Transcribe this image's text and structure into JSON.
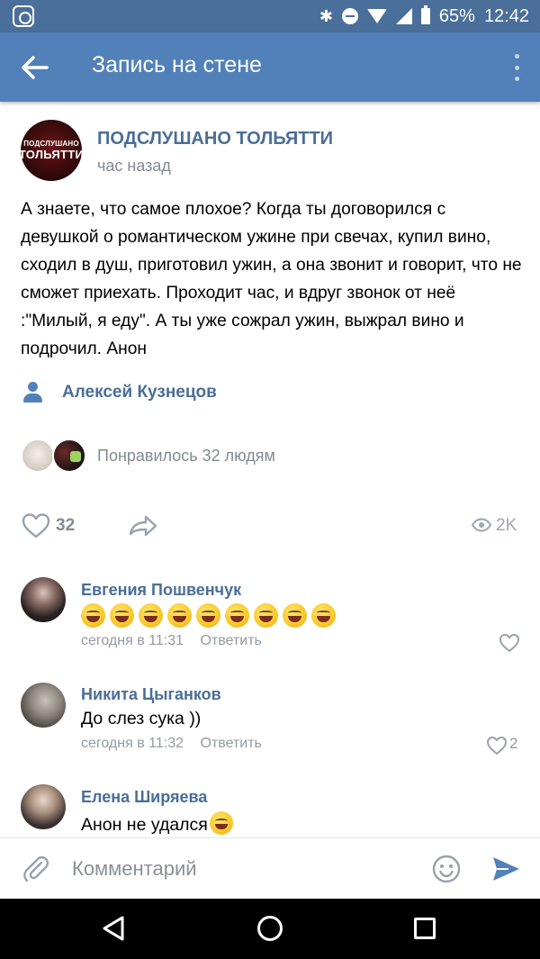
{
  "status_bar": {
    "battery": "65%",
    "time": "12:42"
  },
  "app_bar": {
    "title": "Запись на стене"
  },
  "post": {
    "avatar_text_line1": "ПОДСЛУШАНО",
    "avatar_text_line2": "ТОЛЬЯТТИ",
    "author": "ПОДСЛУШАНО ТОЛЬЯТТИ",
    "time": "час назад",
    "text": "А знаете, что самое плохое? Когда ты договорился с девушкой о романтическом ужине при свечах, купил вино, сходил в душ, приготовил ужин, а она звонит и говорит, что не сможет приехать. Проходит час, и вдруг звонок от неё :\"Милый, я еду\". А ты уже сожрал ужин, выжрал вино и подрочил. Анон",
    "signer": "Алексей Кузнецов",
    "likers_text": "Понравилось 32 людям",
    "likes": "32",
    "views": "2K"
  },
  "comments": [
    {
      "name": "Евгения Пошвенчук",
      "emoji_count": 9,
      "time": "сегодня в 11:31",
      "reply": "Ответить",
      "likes": ""
    },
    {
      "name": "Никита Цыганков",
      "text": "До слез сука ))",
      "time": "сегодня в 11:32",
      "reply": "Ответить",
      "likes": "2"
    },
    {
      "name": "Елена Ширяева",
      "text": "Анон не удался"
    }
  ],
  "composer": {
    "placeholder": "Комментарий"
  },
  "colors": {
    "app_bar": "#5181b8",
    "status_bar": "#4a6f9a",
    "link": "#4a6e98",
    "secondary_text": "#828a93"
  }
}
